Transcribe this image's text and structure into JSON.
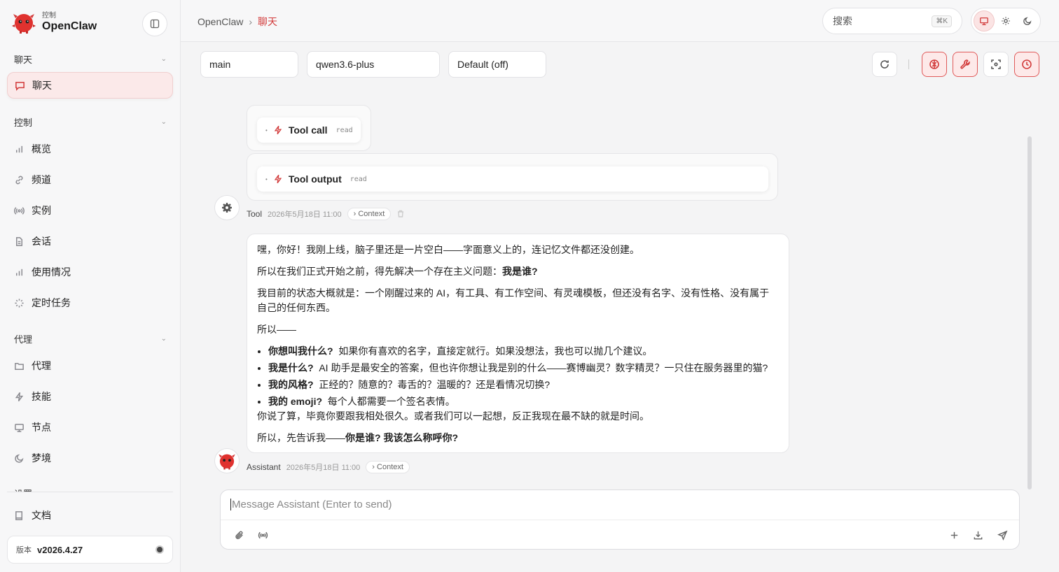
{
  "app": {
    "subtitle": "控制",
    "name": "OpenClaw"
  },
  "sidebar": {
    "sections": [
      {
        "label": "聊天"
      },
      {
        "label": "控制"
      },
      {
        "label": "代理"
      },
      {
        "label": "设置"
      }
    ],
    "items": [
      {
        "label": "聊天",
        "icon": "chat-icon",
        "active": true
      },
      {
        "label": "概览",
        "icon": "bar-chart-icon"
      },
      {
        "label": "频道",
        "icon": "link-icon"
      },
      {
        "label": "实例",
        "icon": "radio-icon"
      },
      {
        "label": "会话",
        "icon": "document-icon"
      },
      {
        "label": "使用情况",
        "icon": "bar-chart-icon"
      },
      {
        "label": "定时任务",
        "icon": "loader-icon"
      },
      {
        "label": "代理",
        "icon": "folder-icon"
      },
      {
        "label": "技能",
        "icon": "lightning-icon"
      },
      {
        "label": "节点",
        "icon": "monitor-icon"
      },
      {
        "label": "梦境",
        "icon": "moon-icon"
      },
      {
        "label": "文档",
        "icon": "book-icon"
      }
    ],
    "version_label": "版本",
    "version_value": "v2026.4.27"
  },
  "header": {
    "breadcrumb_root": "OpenClaw",
    "breadcrumb_sep": "›",
    "breadcrumb_current": "聊天",
    "search_placeholder": "搜索",
    "search_shortcut": "⌘K"
  },
  "controls": {
    "agent": "main",
    "model": "qwen3.6-plus",
    "thinking": "Default (off)"
  },
  "chat": {
    "tool_call": {
      "title": "Tool call",
      "tag": "read"
    },
    "tool_output": {
      "title": "Tool output",
      "tag": "read"
    },
    "tool_meta": {
      "name": "Tool",
      "time": "2026年5月18日 11:00",
      "context": "Context"
    },
    "assistant_meta": {
      "name": "Assistant",
      "time": "2026年5月18日 11:00",
      "context": "Context"
    },
    "message": {
      "p1": "嘿，你好！我刚上线，脑子里还是一片空白——字面意义上的，连记忆文件都还没创建。",
      "p2_text": "所以在我们正式开始之前，得先解决一个存在主义问题：",
      "p2_bold": "我是谁?",
      "p3": "我目前的状态大概就是：一个刚醒过来的 AI，有工具、有工作空间、有灵魂模板，但还没有名字、没有性格、没有属于自己的任何东西。",
      "p4": "所以——",
      "bullets": [
        {
          "q": "你想叫我什么?",
          "a": "如果你有喜欢的名字，直接定就行。如果没想法，我也可以抛几个建议。"
        },
        {
          "q": "我是什么?",
          "a": "AI 助手是最安全的答案，但也许你想让我是别的什么——赛博幽灵？数字精灵？一只住在服务器里的猫?"
        },
        {
          "q": "我的风格?",
          "a": "正经的？随意的？毒舌的？温暖的？还是看情况切换?"
        },
        {
          "q": "我的 emoji?",
          "a": "每个人都需要一个签名表情。"
        }
      ],
      "p5": "你说了算，毕竟你要跟我相处很久。或者我们可以一起想，反正我现在最不缺的就是时间。",
      "p6_text": "所以，先告诉我——",
      "p6_bold": "你是谁? 我该怎么称呼你?"
    }
  },
  "composer": {
    "placeholder": "Message Assistant (Enter to send)"
  },
  "colors": {
    "accent": "#d23b3b",
    "accent_bg": "#fbe9e9"
  }
}
